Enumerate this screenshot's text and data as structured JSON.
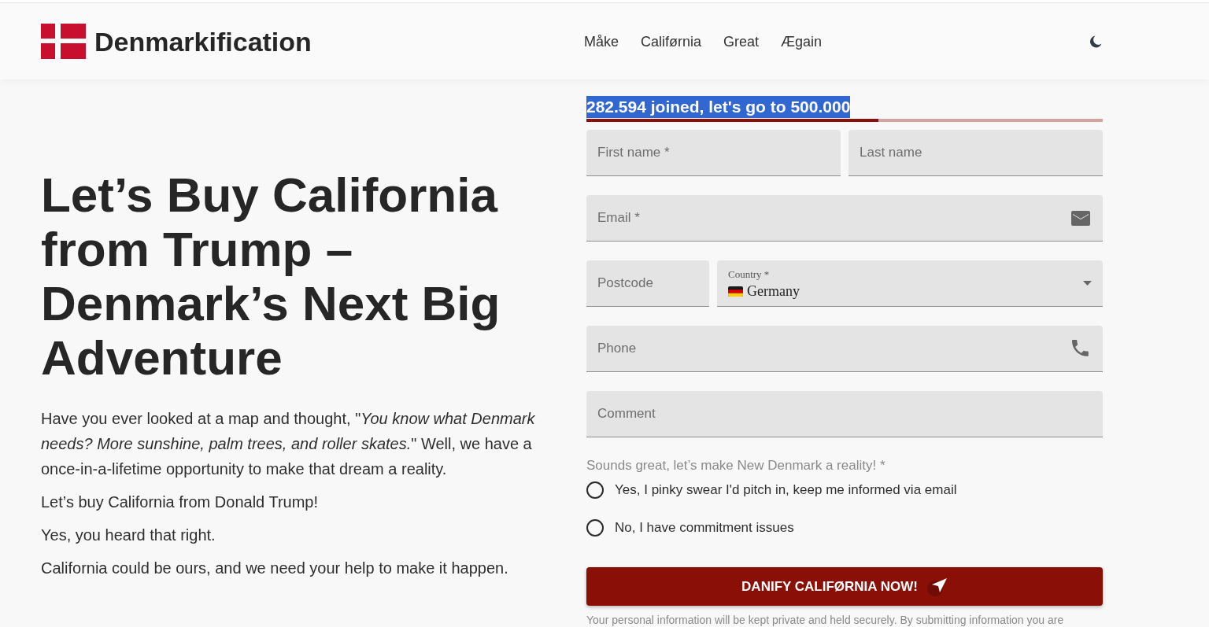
{
  "header": {
    "logo": "Denmarkification",
    "nav": [
      {
        "label": "Måke"
      },
      {
        "label": "Califørnia"
      },
      {
        "label": "Great"
      },
      {
        "label": "Ægain"
      }
    ]
  },
  "hero": {
    "title": "Let’s Buy California from Trump – Denmark’s Next Big Adventure",
    "paragraphs": [
      "Have you ever looked at a map and thought, \"*You know what Denmark needs? More sunshine, palm trees, and roller skates.*\" Well, we have a once-in-a-lifetime opportunity to make that dream a reality.",
      "Let’s buy California from Donald Trump!",
      "Yes, you heard that right.",
      "California could be ours, and we need your help to make it happen."
    ]
  },
  "signup": {
    "progress": {
      "label": "282.594 joined, let's go to 500.000",
      "highlighted": true,
      "level": 0.565
    },
    "field_rows": [
      [
        {
          "kind": "text",
          "placeholder": "First name *"
        },
        {
          "kind": "text",
          "placeholder": "Last name"
        }
      ],
      [
        {
          "kind": "email",
          "placeholder": "Email *"
        }
      ],
      [
        {
          "kind": "text",
          "placeholder": "Postcode"
        },
        {
          "kind": "select",
          "label": "Country *",
          "value": "Germany"
        }
      ],
      [
        {
          "kind": "phone",
          "placeholder": "Phone"
        }
      ],
      [
        {
          "kind": "text",
          "placeholder": "Comment"
        }
      ]
    ],
    "consent": {
      "question": "Sounds great, let’s make New Denmark a reality! *",
      "options": [
        {
          "label": "Yes, I pinky swear I'd pitch in, keep me informed via email",
          "selected": false
        },
        {
          "label": "No, I have commitment issues",
          "selected": false
        }
      ]
    },
    "submit": {
      "label": "DANIFY CALIFØRNIA NOW!"
    },
    "disclaimer": "Your personal information will be kept private and held securely. By submitting information you are"
  }
}
